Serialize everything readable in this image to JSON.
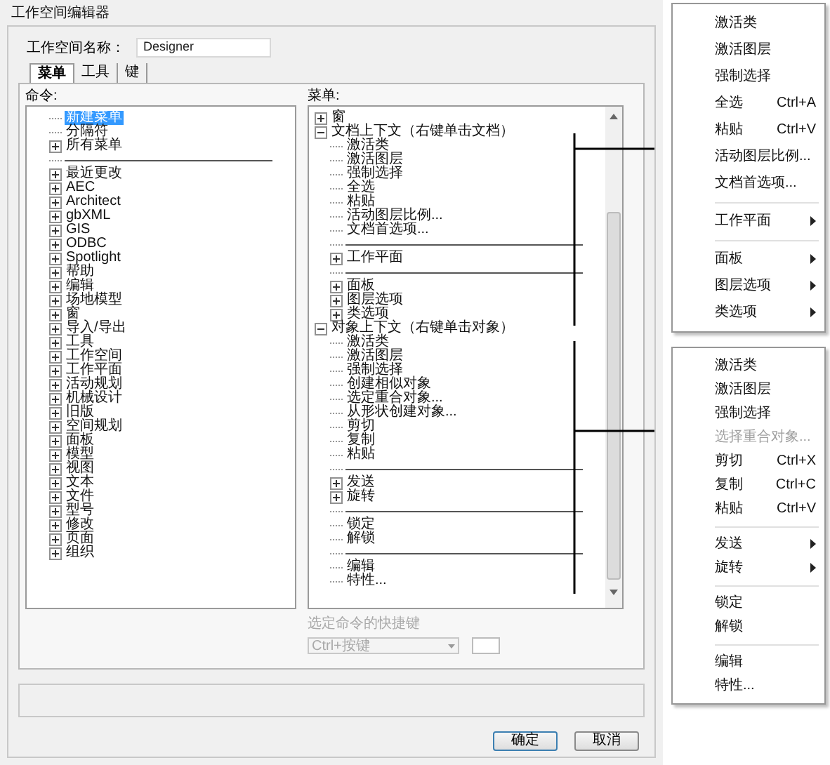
{
  "window": {
    "title": "工作空间编辑器"
  },
  "name_field": {
    "label": "工作空间名称：",
    "value": "Designer"
  },
  "tabs": [
    {
      "label": "菜单",
      "selected": true
    },
    {
      "label": "工具",
      "selected": false
    },
    {
      "label": "键",
      "selected": false
    }
  ],
  "commands": {
    "label": "命令:",
    "items": [
      {
        "kind": "leaf",
        "label": "新建菜单",
        "selected": true
      },
      {
        "kind": "leaf",
        "label": "分隔符",
        "selected": false
      },
      {
        "kind": "folder",
        "label": "所有菜单",
        "selected": false,
        "expanded": false
      },
      {
        "kind": "separator"
      },
      {
        "kind": "folder",
        "label": "最近更改",
        "selected": false,
        "expanded": false
      },
      {
        "kind": "folder",
        "label": "AEC",
        "selected": false,
        "expanded": false
      },
      {
        "kind": "folder",
        "label": "Architect",
        "selected": false,
        "expanded": false
      },
      {
        "kind": "folder",
        "label": "gbXML",
        "selected": false,
        "expanded": false
      },
      {
        "kind": "folder",
        "label": "GIS",
        "selected": false,
        "expanded": false
      },
      {
        "kind": "folder",
        "label": "ODBC",
        "selected": false,
        "expanded": false
      },
      {
        "kind": "folder",
        "label": "Spotlight",
        "selected": false,
        "expanded": false
      },
      {
        "kind": "folder",
        "label": "帮助",
        "selected": false,
        "expanded": false
      },
      {
        "kind": "folder",
        "label": "编辑",
        "selected": false,
        "expanded": false
      },
      {
        "kind": "folder",
        "label": "场地模型",
        "selected": false,
        "expanded": false
      },
      {
        "kind": "folder",
        "label": "窗",
        "selected": false,
        "expanded": false
      },
      {
        "kind": "folder",
        "label": "导入/导出",
        "selected": false,
        "expanded": false
      },
      {
        "kind": "folder",
        "label": "工具",
        "selected": false,
        "expanded": false
      },
      {
        "kind": "folder",
        "label": "工作空间",
        "selected": false,
        "expanded": false
      },
      {
        "kind": "folder",
        "label": "工作平面",
        "selected": false,
        "expanded": false
      },
      {
        "kind": "folder",
        "label": "活动规划",
        "selected": false,
        "expanded": false
      },
      {
        "kind": "folder",
        "label": "机械设计",
        "selected": false,
        "expanded": false
      },
      {
        "kind": "folder",
        "label": "旧版",
        "selected": false,
        "expanded": false
      },
      {
        "kind": "folder",
        "label": "空间规划",
        "selected": false,
        "expanded": false
      },
      {
        "kind": "folder",
        "label": "面板",
        "selected": false,
        "expanded": false
      },
      {
        "kind": "folder",
        "label": "模型",
        "selected": false,
        "expanded": false
      },
      {
        "kind": "folder",
        "label": "视图",
        "selected": false,
        "expanded": false
      },
      {
        "kind": "folder",
        "label": "文本",
        "selected": false,
        "expanded": false
      },
      {
        "kind": "folder",
        "label": "文件",
        "selected": false,
        "expanded": false
      },
      {
        "kind": "folder",
        "label": "型号",
        "selected": false,
        "expanded": false
      },
      {
        "kind": "folder",
        "label": "修改",
        "selected": false,
        "expanded": false
      },
      {
        "kind": "folder",
        "label": "页面",
        "selected": false,
        "expanded": false
      },
      {
        "kind": "folder",
        "label": "组织",
        "selected": false,
        "expanded": false
      }
    ]
  },
  "menus": {
    "label": "菜单:",
    "items": [
      {
        "kind": "folder",
        "label": "窗",
        "selected": false,
        "expanded": false
      },
      {
        "kind": "folder",
        "label": "文档上下文（右键单击文档）",
        "selected": false,
        "expanded": true,
        "children": [
          {
            "kind": "leaf",
            "label": "激活类",
            "selected": false
          },
          {
            "kind": "leaf",
            "label": "激活图层",
            "selected": false
          },
          {
            "kind": "leaf",
            "label": "强制选择",
            "selected": false
          },
          {
            "kind": "leaf",
            "label": "全选",
            "selected": false
          },
          {
            "kind": "leaf",
            "label": "粘贴",
            "selected": false
          },
          {
            "kind": "leaf",
            "label": "活动图层比例...",
            "selected": false
          },
          {
            "kind": "leaf",
            "label": "文档首选项...",
            "selected": false
          },
          {
            "kind": "separator"
          },
          {
            "kind": "folder",
            "label": "工作平面",
            "selected": false,
            "expanded": false
          },
          {
            "kind": "separator"
          },
          {
            "kind": "folder",
            "label": "面板",
            "selected": false,
            "expanded": false
          },
          {
            "kind": "folder",
            "label": "图层选项",
            "selected": false,
            "expanded": false
          },
          {
            "kind": "folder",
            "label": "类选项",
            "selected": false,
            "expanded": false
          }
        ]
      },
      {
        "kind": "folder",
        "label": "对象上下文（右键单击对象）",
        "selected": false,
        "expanded": true,
        "children": [
          {
            "kind": "leaf",
            "label": "激活类",
            "selected": false
          },
          {
            "kind": "leaf",
            "label": "激活图层",
            "selected": false
          },
          {
            "kind": "leaf",
            "label": "强制选择",
            "selected": false
          },
          {
            "kind": "leaf",
            "label": "创建相似对象",
            "selected": false
          },
          {
            "kind": "leaf",
            "label": "选定重合对象...",
            "selected": false
          },
          {
            "kind": "leaf",
            "label": "从形状创建对象...",
            "selected": false
          },
          {
            "kind": "leaf",
            "label": "剪切",
            "selected": false
          },
          {
            "kind": "leaf",
            "label": "复制",
            "selected": false
          },
          {
            "kind": "leaf",
            "label": "粘贴",
            "selected": false
          },
          {
            "kind": "separator"
          },
          {
            "kind": "folder",
            "label": "发送",
            "selected": false,
            "expanded": false
          },
          {
            "kind": "folder",
            "label": "旋转",
            "selected": false,
            "expanded": false
          },
          {
            "kind": "separator"
          },
          {
            "kind": "leaf",
            "label": "锁定",
            "selected": false
          },
          {
            "kind": "leaf",
            "label": "解锁",
            "selected": false
          },
          {
            "kind": "separator"
          },
          {
            "kind": "leaf",
            "label": "编辑",
            "selected": false
          },
          {
            "kind": "leaf",
            "label": "特性...",
            "selected": false
          }
        ]
      }
    ]
  },
  "shortcut": {
    "label": "选定命令的快捷键",
    "dropdown": "Ctrl+按键",
    "disabled": true
  },
  "buttons": [
    {
      "label": "确定",
      "default": true
    },
    {
      "label": "取消",
      "default": false
    }
  ],
  "context_menus": [
    {
      "items": [
        {
          "kind": "item",
          "label": "激活类"
        },
        {
          "kind": "item",
          "label": "激活图层"
        },
        {
          "kind": "item",
          "label": "强制选择"
        },
        {
          "kind": "item",
          "label": "全选",
          "shortcut": "Ctrl+A"
        },
        {
          "kind": "item",
          "label": "粘贴",
          "shortcut": "Ctrl+V"
        },
        {
          "kind": "item",
          "label": "活动图层比例..."
        },
        {
          "kind": "item",
          "label": "文档首选项..."
        },
        {
          "kind": "separator"
        },
        {
          "kind": "submenu",
          "label": "工作平面"
        },
        {
          "kind": "separator"
        },
        {
          "kind": "submenu",
          "label": "面板"
        },
        {
          "kind": "submenu",
          "label": "图层选项"
        },
        {
          "kind": "submenu",
          "label": "类选项"
        }
      ]
    },
    {
      "items": [
        {
          "kind": "item",
          "label": "激活类"
        },
        {
          "kind": "item",
          "label": "激活图层"
        },
        {
          "kind": "item",
          "label": "强制选择"
        },
        {
          "kind": "item",
          "label": "选择重合对象...",
          "disabled": true
        },
        {
          "kind": "item",
          "label": "剪切",
          "shortcut": "Ctrl+X"
        },
        {
          "kind": "item",
          "label": "复制",
          "shortcut": "Ctrl+C"
        },
        {
          "kind": "item",
          "label": "粘贴",
          "shortcut": "Ctrl+V"
        },
        {
          "kind": "separator"
        },
        {
          "kind": "submenu",
          "label": "发送"
        },
        {
          "kind": "submenu",
          "label": "旋转"
        },
        {
          "kind": "separator"
        },
        {
          "kind": "item",
          "label": "锁定"
        },
        {
          "kind": "item",
          "label": "解锁"
        },
        {
          "kind": "separator"
        },
        {
          "kind": "item",
          "label": "编辑"
        },
        {
          "kind": "item",
          "label": "特性..."
        }
      ]
    }
  ]
}
